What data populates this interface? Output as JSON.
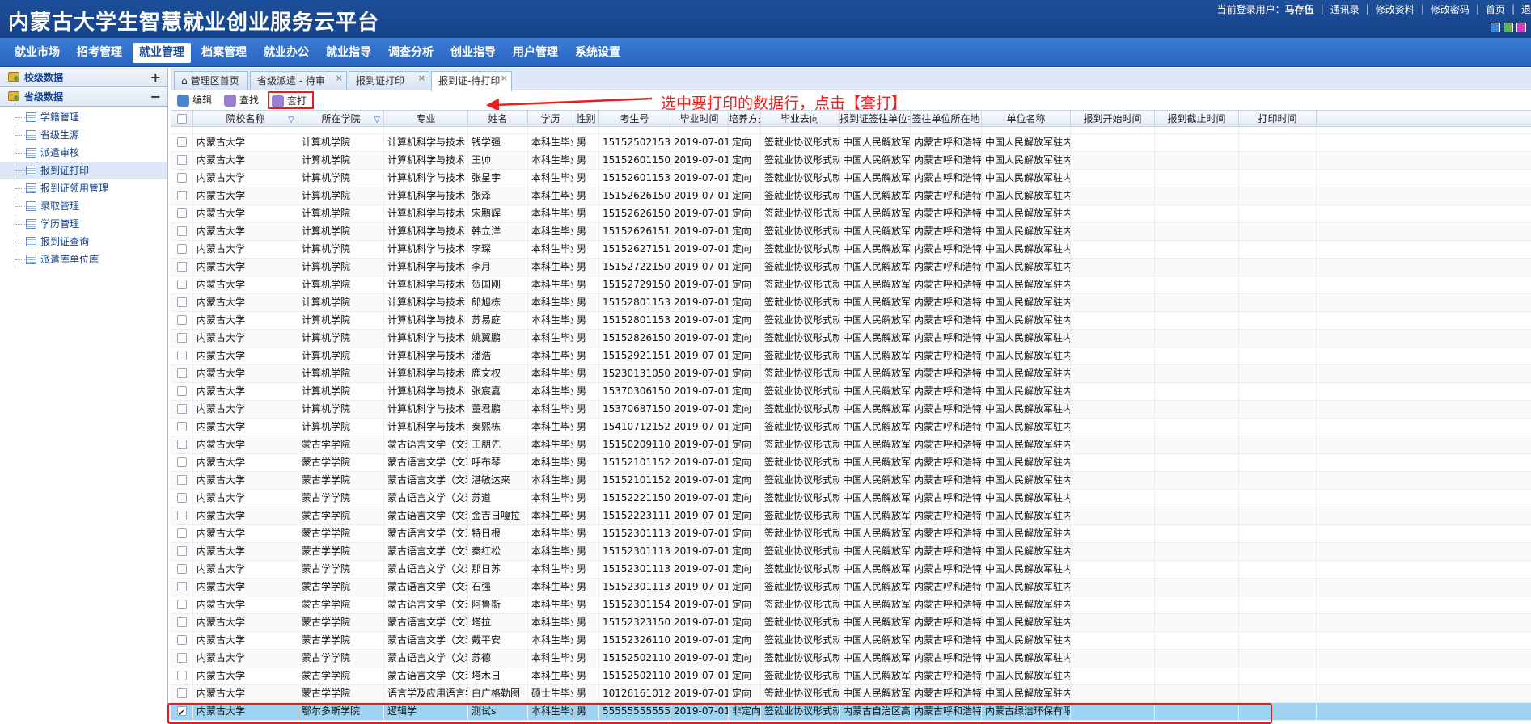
{
  "app": {
    "title": "内蒙古大学生智慧就业创业服务云平台",
    "user_prefix": "当前登录用户：",
    "user_name": "马存伍",
    "links": [
      "通讯录",
      "修改资料",
      "修改密码",
      "首页",
      "退"
    ],
    "skin_colors": [
      "#3a86d8",
      "#5ab552",
      "#d43ac4"
    ]
  },
  "nav": [
    "就业市场",
    "招考管理",
    "就业管理",
    "档案管理",
    "就业办公",
    "就业指导",
    "调查分析",
    "创业指导",
    "用户管理",
    "系统设置"
  ],
  "nav_active": 2,
  "sidebar": {
    "sections": [
      {
        "label": "校级数据",
        "toggle": "+"
      },
      {
        "label": "省级数据",
        "toggle": "−"
      }
    ],
    "items": [
      "学籍管理",
      "省级生源",
      "派遣审核",
      "报到证打印",
      "报到证领用管理",
      "录取管理",
      "学历管理",
      "报到证查询",
      "派遣库单位库"
    ],
    "selected_index": 3
  },
  "tabs": [
    {
      "label": "管理区首页",
      "closable": false
    },
    {
      "label": "省级派遣 - 待审",
      "closable": true
    },
    {
      "label": "报到证打印",
      "closable": true
    },
    {
      "label": "报到证-待打印",
      "closable": true
    }
  ],
  "toolbar": {
    "edit": "编辑",
    "find": "查找",
    "print": "套打",
    "annotation": "选中要打印的数据行，点击【套打】"
  },
  "table": {
    "columns": [
      "院校名称",
      "所在学院",
      "专业",
      "姓名",
      "学历",
      "性别",
      "考生号",
      "毕业时间",
      "培养方式",
      "毕业去向",
      "报到证签往单位名称",
      "签往单位所在地",
      "单位名称",
      "报到开始时间",
      "报到截止时间",
      "打印时间"
    ],
    "rows": [
      [
        "内蒙古大学",
        "计算机学院",
        "计算机科学与技术",
        "钱学强",
        "本科生毕业",
        "男",
        "15152502153058",
        "2019-07-01",
        "定向",
        "签就业协议形式就业",
        "中国人民解放军驻内蒙",
        "内蒙古呼和浩特市",
        "中国人民解放军驻内蒙",
        "",
        "",
        ""
      ],
      [
        "内蒙古大学",
        "计算机学院",
        "计算机科学与技术",
        "王帅",
        "本科生毕业",
        "男",
        "15152601150041",
        "2019-07-01",
        "定向",
        "签就业协议形式就业",
        "中国人民解放军驻内蒙",
        "内蒙古呼和浩特市",
        "中国人民解放军驻内蒙",
        "",
        "",
        ""
      ],
      [
        "内蒙古大学",
        "计算机学院",
        "计算机科学与技术",
        "张星宇",
        "本科生毕业",
        "男",
        "15152601153732",
        "2019-07-01",
        "定向",
        "签就业协议形式就业",
        "中国人民解放军驻内蒙",
        "内蒙古呼和浩特市",
        "中国人民解放军驻内蒙",
        "",
        "",
        ""
      ],
      [
        "内蒙古大学",
        "计算机学院",
        "计算机科学与技术",
        "张泽",
        "本科生毕业",
        "男",
        "15152626150186",
        "2019-07-01",
        "定向",
        "签就业协议形式就业",
        "中国人民解放军驻内蒙",
        "内蒙古呼和浩特市",
        "中国人民解放军驻内蒙",
        "",
        "",
        ""
      ],
      [
        "内蒙古大学",
        "计算机学院",
        "计算机科学与技术",
        "宋鹏辉",
        "本科生毕业",
        "男",
        "15152626150469",
        "2019-07-01",
        "定向",
        "签就业协议形式就业",
        "中国人民解放军驻内蒙",
        "内蒙古呼和浩特市",
        "中国人民解放军驻内蒙",
        "",
        "",
        ""
      ],
      [
        "内蒙古大学",
        "计算机学院",
        "计算机科学与技术",
        "韩立洋",
        "本科生毕业",
        "男",
        "15152626151554",
        "2019-07-01",
        "定向",
        "签就业协议形式就业",
        "中国人民解放军驻内蒙",
        "内蒙古呼和浩特市",
        "中国人民解放军驻内蒙",
        "",
        "",
        ""
      ],
      [
        "内蒙古大学",
        "计算机学院",
        "计算机科学与技术",
        "李琛",
        "本科生毕业",
        "男",
        "15152627151099",
        "2019-07-01",
        "定向",
        "签就业协议形式就业",
        "中国人民解放军驻内蒙",
        "内蒙古呼和浩特市",
        "中国人民解放军驻内蒙",
        "",
        "",
        ""
      ],
      [
        "内蒙古大学",
        "计算机学院",
        "计算机科学与技术",
        "李月",
        "本科生毕业",
        "男",
        "15152722150819",
        "2019-07-01",
        "定向",
        "签就业协议形式就业",
        "中国人民解放军驻内蒙",
        "内蒙古呼和浩特市",
        "中国人民解放军驻内蒙",
        "",
        "",
        ""
      ],
      [
        "内蒙古大学",
        "计算机学院",
        "计算机科学与技术",
        "贺国刚",
        "本科生毕业",
        "男",
        "15152729150242",
        "2019-07-01",
        "定向",
        "签就业协议形式就业",
        "中国人民解放军驻内蒙",
        "内蒙古呼和浩特市",
        "中国人民解放军驻内蒙",
        "",
        "",
        ""
      ],
      [
        "内蒙古大学",
        "计算机学院",
        "计算机科学与技术",
        "郎旭栋",
        "本科生毕业",
        "男",
        "15152801153662",
        "2019-07-01",
        "定向",
        "签就业协议形式就业",
        "中国人民解放军驻内蒙",
        "内蒙古呼和浩特市",
        "中国人民解放军驻内蒙",
        "",
        "",
        ""
      ],
      [
        "内蒙古大学",
        "计算机学院",
        "计算机科学与技术",
        "苏易庭",
        "本科生毕业",
        "男",
        "15152801153748",
        "2019-07-01",
        "定向",
        "签就业协议形式就业",
        "中国人民解放军驻内蒙",
        "内蒙古呼和浩特市",
        "中国人民解放军驻内蒙",
        "",
        "",
        ""
      ],
      [
        "内蒙古大学",
        "计算机学院",
        "计算机科学与技术",
        "姚翼鹏",
        "本科生毕业",
        "男",
        "15152826150206",
        "2019-07-01",
        "定向",
        "签就业协议形式就业",
        "中国人民解放军驻内蒙",
        "内蒙古呼和浩特市",
        "中国人民解放军驻内蒙",
        "",
        "",
        ""
      ],
      [
        "内蒙古大学",
        "计算机学院",
        "计算机科学与技术",
        "潘浩",
        "本科生毕业",
        "男",
        "15152921151358",
        "2019-07-01",
        "定向",
        "签就业协议形式就业",
        "中国人民解放军驻内蒙",
        "内蒙古呼和浩特市",
        "中国人民解放军驻内蒙",
        "",
        "",
        ""
      ],
      [
        "内蒙古大学",
        "计算机学院",
        "计算机科学与技术",
        "鹿文权",
        "本科生毕业",
        "男",
        "15230131050458",
        "2019-07-01",
        "定向",
        "签就业协议形式就业",
        "中国人民解放军驻内蒙",
        "内蒙古呼和浩特市",
        "中国人民解放军驻内蒙",
        "",
        "",
        ""
      ],
      [
        "内蒙古大学",
        "计算机学院",
        "计算机科学与技术",
        "张宸嘉",
        "本科生毕业",
        "男",
        "15370306150292",
        "2019-07-01",
        "定向",
        "签就业协议形式就业",
        "中国人民解放军驻内蒙",
        "内蒙古呼和浩特市",
        "中国人民解放军驻内蒙",
        "",
        "",
        ""
      ],
      [
        "内蒙古大学",
        "计算机学院",
        "计算机科学与技术",
        "董君鹏",
        "本科生毕业",
        "男",
        "15370687150406",
        "2019-07-01",
        "定向",
        "签就业协议形式就业",
        "中国人民解放军驻内蒙",
        "内蒙古呼和浩特市",
        "中国人民解放军驻内蒙",
        "",
        "",
        ""
      ],
      [
        "内蒙古大学",
        "计算机学院",
        "计算机科学与技术",
        "秦熙栋",
        "本科生毕业",
        "男",
        "15410712152712",
        "2019-07-01",
        "定向",
        "签就业协议形式就业",
        "中国人民解放军驻内蒙",
        "内蒙古呼和浩特市",
        "中国人民解放军驻内蒙",
        "",
        "",
        ""
      ],
      [
        "内蒙古大学",
        "蒙古学学院",
        "蒙古语言文学（文理综",
        "王朋先",
        "本科生毕业",
        "男",
        "15150209110297",
        "2019-07-01",
        "定向",
        "签就业协议形式就业",
        "中国人民解放军驻内蒙",
        "内蒙古呼和浩特市",
        "中国人民解放军驻内蒙",
        "",
        "",
        ""
      ],
      [
        "内蒙古大学",
        "蒙古学学院",
        "蒙古语言文学（文理综",
        "呼布琴",
        "本科生毕业",
        "男",
        "15152101152352",
        "2019-07-01",
        "定向",
        "签就业协议形式就业",
        "中国人民解放军驻内蒙",
        "内蒙古呼和浩特市",
        "中国人民解放军驻内蒙",
        "",
        "",
        ""
      ],
      [
        "内蒙古大学",
        "蒙古学学院",
        "蒙古语言文学（文理综",
        "湛敏达来",
        "本科生毕业",
        "男",
        "15152101152353",
        "2019-07-01",
        "定向",
        "签就业协议形式就业",
        "中国人民解放军驻内蒙",
        "内蒙古呼和浩特市",
        "中国人民解放军驻内蒙",
        "",
        "",
        ""
      ],
      [
        "内蒙古大学",
        "蒙古学学院",
        "蒙古语言文学（文理综",
        "苏道",
        "本科生毕业",
        "男",
        "15152221150370",
        "2019-07-01",
        "定向",
        "签就业协议形式就业",
        "中国人民解放军驻内蒙",
        "内蒙古呼和浩特市",
        "中国人民解放军驻内蒙",
        "",
        "",
        ""
      ],
      [
        "内蒙古大学",
        "蒙古学学院",
        "蒙古语言文学（文理综",
        "金吉日嘎拉",
        "本科生毕业",
        "男",
        "15152223111152",
        "2019-07-01",
        "定向",
        "签就业协议形式就业",
        "中国人民解放军驻内蒙",
        "内蒙古呼和浩特市",
        "中国人民解放军驻内蒙",
        "",
        "",
        ""
      ],
      [
        "内蒙古大学",
        "蒙古学学院",
        "蒙古语言文学（文理综",
        "特日根",
        "本科生毕业",
        "男",
        "15152301113758",
        "2019-07-01",
        "定向",
        "签就业协议形式就业",
        "中国人民解放军驻内蒙",
        "内蒙古呼和浩特市",
        "中国人民解放军驻内蒙",
        "",
        "",
        ""
      ],
      [
        "内蒙古大学",
        "蒙古学学院",
        "蒙古语言文学（文理综",
        "秦红松",
        "本科生毕业",
        "男",
        "15152301113787",
        "2019-07-01",
        "定向",
        "签就业协议形式就业",
        "中国人民解放军驻内蒙",
        "内蒙古呼和浩特市",
        "中国人民解放军驻内蒙",
        "",
        "",
        ""
      ],
      [
        "内蒙古大学",
        "蒙古学学院",
        "蒙古语言文学（文理综",
        "那日苏",
        "本科生毕业",
        "男",
        "15152301113789",
        "2019-07-01",
        "定向",
        "签就业协议形式就业",
        "中国人民解放军驻内蒙",
        "内蒙古呼和浩特市",
        "中国人民解放军驻内蒙",
        "",
        "",
        ""
      ],
      [
        "内蒙古大学",
        "蒙古学学院",
        "蒙古语言文学（文理综",
        "石强",
        "本科生毕业",
        "男",
        "15152301113799",
        "2019-07-01",
        "定向",
        "签就业协议形式就业",
        "中国人民解放军驻内蒙",
        "内蒙古呼和浩特市",
        "中国人民解放军驻内蒙",
        "",
        "",
        ""
      ],
      [
        "内蒙古大学",
        "蒙古学学院",
        "蒙古语言文学（文理综",
        "阿鲁斯",
        "本科生毕业",
        "男",
        "15152301154636",
        "2019-07-01",
        "定向",
        "签就业协议形式就业",
        "中国人民解放军驻内蒙",
        "内蒙古呼和浩特市",
        "中国人民解放军驻内蒙",
        "",
        "",
        ""
      ],
      [
        "内蒙古大学",
        "蒙古学学院",
        "蒙古语言文学（文理综",
        "塔拉",
        "本科生毕业",
        "男",
        "15152323150852",
        "2019-07-01",
        "定向",
        "签就业协议形式就业",
        "中国人民解放军驻内蒙",
        "内蒙古呼和浩特市",
        "中国人民解放军驻内蒙",
        "",
        "",
        ""
      ],
      [
        "内蒙古大学",
        "蒙古学学院",
        "蒙古语言文学（文理综",
        "戴平安",
        "本科生毕业",
        "男",
        "15152326110407",
        "2019-07-01",
        "定向",
        "签就业协议形式就业",
        "中国人民解放军驻内蒙",
        "内蒙古呼和浩特市",
        "中国人民解放军驻内蒙",
        "",
        "",
        ""
      ],
      [
        "内蒙古大学",
        "蒙古学学院",
        "蒙古语言文学（文理综",
        "苏德",
        "本科生毕业",
        "男",
        "15152502110346",
        "2019-07-01",
        "定向",
        "签就业协议形式就业",
        "中国人民解放军驻内蒙",
        "内蒙古呼和浩特市",
        "中国人民解放军驻内蒙",
        "",
        "",
        ""
      ],
      [
        "内蒙古大学",
        "蒙古学学院",
        "蒙古语言文学（文理综",
        "塔木日",
        "本科生毕业",
        "男",
        "15152502110527",
        "2019-07-01",
        "定向",
        "签就业协议形式就业",
        "中国人民解放军驻内蒙",
        "内蒙古呼和浩特市",
        "中国人民解放军驻内蒙",
        "",
        "",
        ""
      ],
      [
        "内蒙古大学",
        "蒙古学学院",
        "语言学及应用语言学",
        "白广格勒图",
        "硕士生毕业",
        "男",
        "101261610126010",
        "2019-07-01",
        "定向",
        "签就业协议形式就业",
        "中国人民解放军驻内蒙",
        "内蒙古呼和浩特市",
        "中国人民解放军驻内蒙",
        "",
        "",
        ""
      ],
      [
        "内蒙古大学",
        "鄂尔多斯学院",
        "逻辑学",
        "测试s",
        "本科生毕业",
        "男",
        "55555555555555",
        "2019-07-01",
        "非定向",
        "签就业协议形式就业",
        "内蒙古自治区高校毕",
        "内蒙古呼和浩特市",
        "内蒙古绿洁环保有限公",
        "",
        "",
        ""
      ]
    ],
    "selected_row": 32
  }
}
